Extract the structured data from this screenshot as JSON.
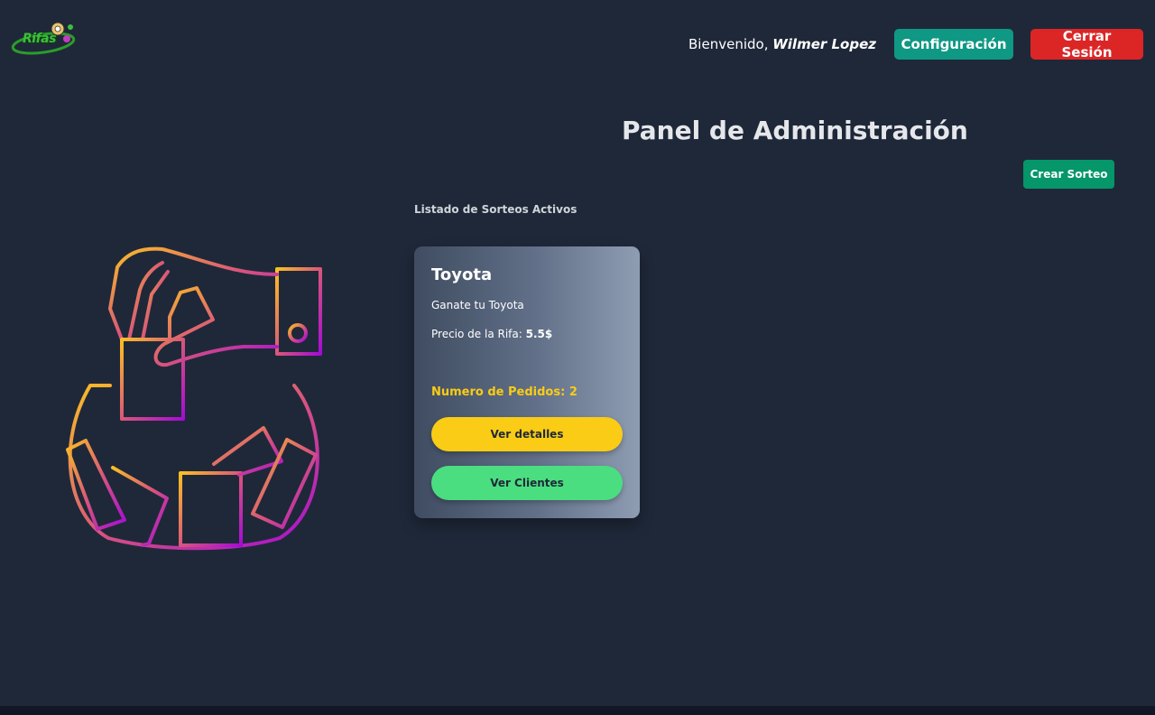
{
  "header": {
    "logo_text": "Rifas",
    "welcome_prefix": "Bienvenido, ",
    "user_name": "Wilmer Lopez",
    "config_label": "Configuración",
    "logout_label": "Cerrar Sesión"
  },
  "main": {
    "title": "Panel de Administración",
    "create_label": "Crear Sorteo",
    "section_label": "Listado de Sorteos Activos",
    "illustration_icon": "hand-dropping-ticket-into-raffle-bowl-icon"
  },
  "raffles": [
    {
      "title": "Toyota",
      "description": "Ganate tu Toyota",
      "price_label": "Precio de la Rifa: ",
      "price_value": "5.5$",
      "orders_label": "Numero de Pedidos: 2",
      "details_label": "Ver detalles",
      "clients_label": "Ver Clientes"
    }
  ],
  "colors": {
    "background": "#1f2839",
    "config_button": "#0f9883",
    "logout_button": "#dc2626",
    "create_button": "#059669",
    "details_button": "#facc15",
    "clients_button": "#4ade80",
    "orders_text": "#facc15",
    "illustration_gradient_start": "#fbbf24",
    "illustration_gradient_end": "#a50bd6"
  }
}
